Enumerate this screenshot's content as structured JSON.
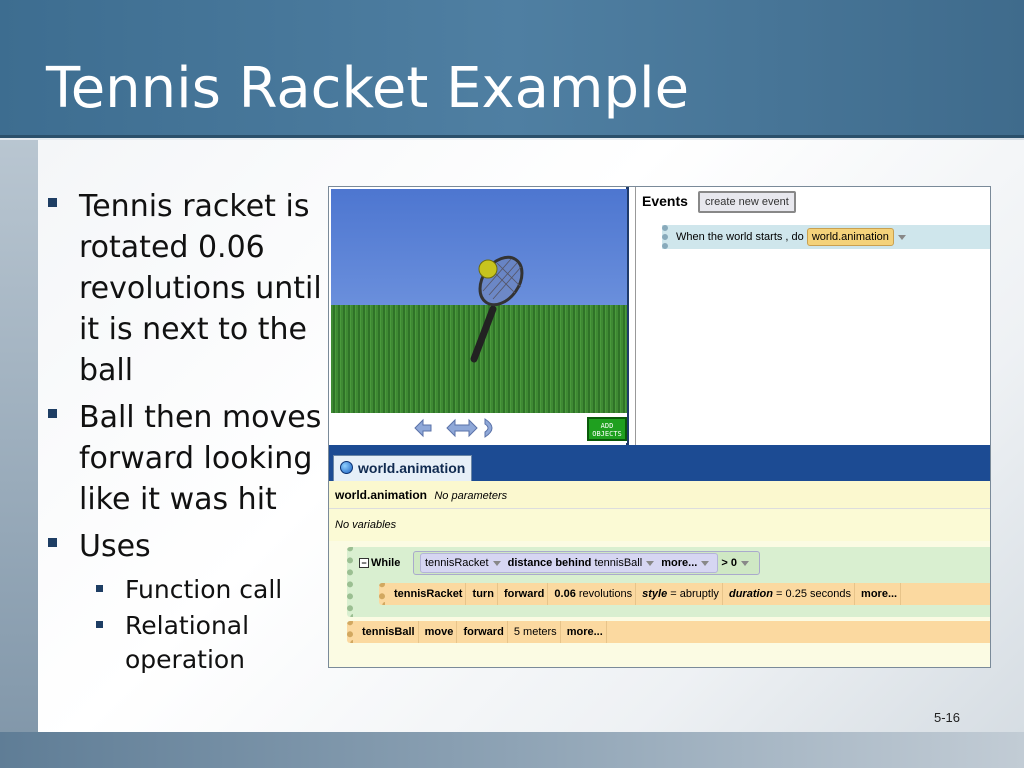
{
  "slide": {
    "title": "Tennis Racket Example",
    "page_number": "5-16",
    "bullets": [
      {
        "text": "Tennis racket is rotated 0.06 revolutions until it is next to the ball",
        "level": 1
      },
      {
        "text": "Ball then moves forward looking like it was hit",
        "level": 1
      },
      {
        "text": "Uses",
        "level": 1
      },
      {
        "text": "Function call",
        "level": 2
      },
      {
        "text": "Relational operation",
        "level": 2
      }
    ]
  },
  "alice": {
    "add_objects": "ADD OBJECTS",
    "events": {
      "header": "Events",
      "create_button": "create new event",
      "row_text": "When the world starts , do",
      "row_target": "world.animation"
    },
    "editor": {
      "tab": "world.animation",
      "method_name": "world.animation",
      "method_params": "No parameters",
      "no_variables": "No variables",
      "while_label": "While",
      "cond": {
        "object": "tennisRacket",
        "func": "distance behind",
        "arg": "tennisBall",
        "more": "more...",
        "op": ">",
        "value": "0"
      },
      "turn": {
        "object": "tennisRacket",
        "verb": "turn",
        "dir": "forward",
        "amount": "0.06",
        "unit": "revolutions",
        "style_key": "style",
        "style_val": "= abruptly",
        "dur_key": "duration",
        "dur_val": "= 0.25",
        "dur_unit": "seconds",
        "more": "more..."
      },
      "move": {
        "object": "tennisBall",
        "verb": "move",
        "dir": "forward",
        "amount": "5 meters",
        "more": "more..."
      }
    }
  },
  "colors": {
    "title_bar": "#4a7a9c",
    "bullet": "#1e3e64",
    "sky": "#4d76d0",
    "grass": "#3f8a34"
  }
}
